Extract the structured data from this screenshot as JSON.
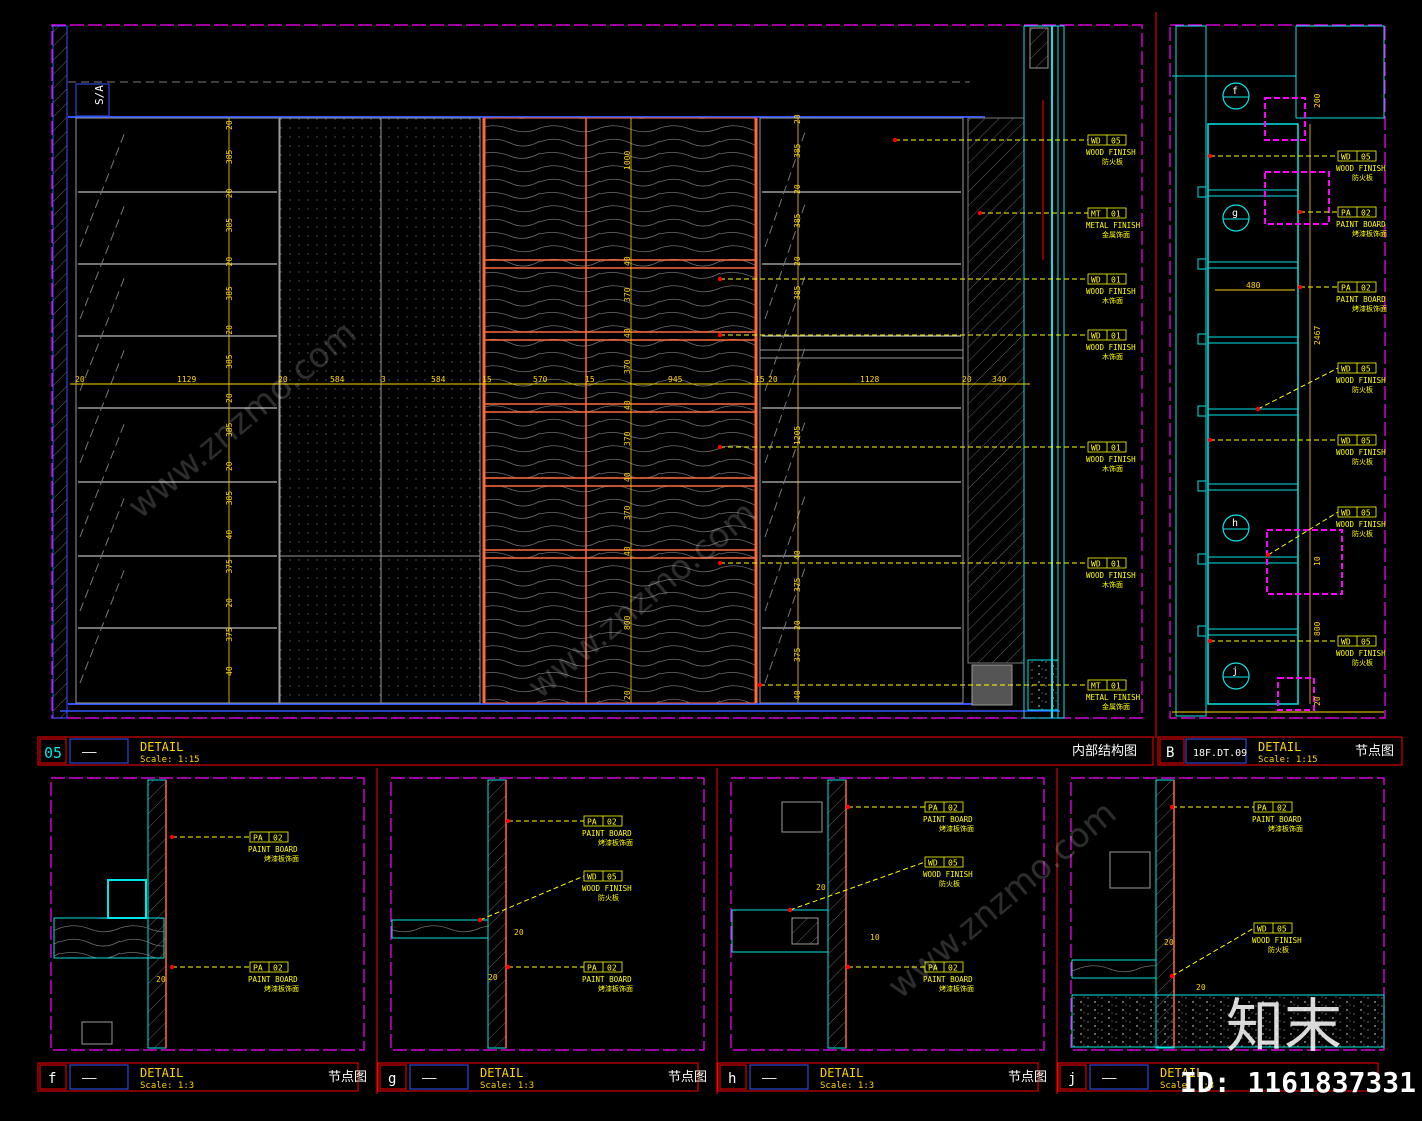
{
  "main": {
    "tag_sa": "S/A",
    "title_num": "05",
    "title_ref": "——",
    "title": "DETAIL",
    "scale": "Scale: 1:15",
    "title_cn": "内部结构图",
    "dims_h": [
      "20",
      "1129",
      "20",
      "584",
      "3",
      "584",
      "15",
      "570",
      "15",
      "945",
      "15",
      "20",
      "1128",
      "20",
      "340"
    ],
    "dims_v_left": [
      "20",
      "385",
      "20",
      "385",
      "20",
      "385",
      "20",
      "385",
      "20",
      "385",
      "20",
      "385",
      "40",
      "375",
      "20",
      "375",
      "40"
    ],
    "dims_v_mid": [
      "1000",
      "40",
      "370",
      "40",
      "370",
      "40",
      "370",
      "40",
      "370",
      "40",
      "800",
      "20"
    ],
    "dims_v_right": [
      "20",
      "385",
      "20",
      "385",
      "20",
      "385",
      "1205",
      "40",
      "375",
      "20",
      "375",
      "40"
    ],
    "callouts": [
      {
        "code": "WD",
        "num": "05",
        "line1": "WOOD FINISH",
        "line2": "防火板"
      },
      {
        "code": "MT",
        "num": "01",
        "line1": "METAL FINISH",
        "line2": "金属饰面"
      },
      {
        "code": "WD",
        "num": "01",
        "line1": "WOOD FINISH",
        "line2": "木饰面"
      },
      {
        "code": "WD",
        "num": "01",
        "line1": "WOOD FINISH",
        "line2": "木饰面"
      },
      {
        "code": "WD",
        "num": "01",
        "line1": "WOOD FINISH",
        "line2": "木饰面"
      },
      {
        "code": "WD",
        "num": "01",
        "line1": "WOOD FINISH",
        "line2": "木饰面"
      },
      {
        "code": "MT",
        "num": "01",
        "line1": "METAL FINISH",
        "line2": "金属饰面"
      }
    ]
  },
  "section_b": {
    "title_num": "B",
    "title_ref": "18F.DT.09",
    "title": "DETAIL",
    "scale": "Scale: 1:15",
    "title_cn": "节点图",
    "markers": [
      "f",
      "g",
      "h",
      "j"
    ],
    "dims": [
      "200",
      "480",
      "2467",
      "10",
      "800",
      "20"
    ],
    "callouts": [
      {
        "code": "WD",
        "num": "05",
        "line1": "WOOD FINISH",
        "line2": "防火板"
      },
      {
        "code": "PA",
        "num": "02",
        "line1": "PAINT BOARD",
        "line2": "烤漆板饰面"
      },
      {
        "code": "PA",
        "num": "02",
        "line1": "PAINT BOARD",
        "line2": "烤漆板饰面"
      },
      {
        "code": "WD",
        "num": "05",
        "line1": "WOOD FINISH",
        "line2": "防火板"
      },
      {
        "code": "WD",
        "num": "05",
        "line1": "WOOD FINISH",
        "line2": "防火板"
      },
      {
        "code": "WD",
        "num": "05",
        "line1": "WOOD FINISH",
        "line2": "防火板"
      },
      {
        "code": "WD",
        "num": "05",
        "line1": "WOOD FINISH",
        "line2": "防火板"
      }
    ]
  },
  "details": [
    {
      "id": "f",
      "title_ref": "——",
      "title": "DETAIL",
      "scale": "Scale: 1:3",
      "title_cn": "节点图",
      "dims": [
        "20"
      ],
      "callouts": [
        {
          "code": "PA",
          "num": "02",
          "line1": "PAINT BOARD",
          "line2": "烤漆板饰面"
        },
        {
          "code": "PA",
          "num": "02",
          "line1": "PAINT BOARD",
          "line2": "烤漆板饰面"
        }
      ]
    },
    {
      "id": "g",
      "title_ref": "——",
      "title": "DETAIL",
      "scale": "Scale: 1:3",
      "title_cn": "节点图",
      "dims": [
        "20",
        "20"
      ],
      "callouts": [
        {
          "code": "PA",
          "num": "02",
          "line1": "PAINT BOARD",
          "line2": "烤漆板饰面"
        },
        {
          "code": "WD",
          "num": "05",
          "line1": "WOOD FINISH",
          "line2": "防火板"
        },
        {
          "code": "PA",
          "num": "02",
          "line1": "PAINT BOARD",
          "line2": "烤漆板饰面"
        }
      ]
    },
    {
      "id": "h",
      "title_ref": "——",
      "title": "DETAIL",
      "scale": "Scale: 1:3",
      "title_cn": "节点图",
      "dims": [
        "20",
        "10"
      ],
      "callouts": [
        {
          "code": "PA",
          "num": "02",
          "line1": "PAINT BOARD",
          "line2": "烤漆板饰面"
        },
        {
          "code": "WD",
          "num": "05",
          "line1": "WOOD FINISH",
          "line2": "防火板"
        },
        {
          "code": "PA",
          "num": "02",
          "line1": "PAINT BOARD",
          "line2": "烤漆板饰面"
        }
      ]
    },
    {
      "id": "j",
      "title_ref": "——",
      "title": "DETAIL",
      "scale": "Scale: 1:3",
      "title_cn": "节点图",
      "dims": [
        "20",
        "20"
      ],
      "callouts": [
        {
          "code": "PA",
          "num": "02",
          "line1": "PAINT BOARD",
          "line2": "烤漆板饰面"
        },
        {
          "code": "WD",
          "num": "05",
          "line1": "WOOD FINISH",
          "line2": "防火板"
        }
      ]
    }
  ],
  "watermark": {
    "brand": "知末",
    "site": "www.znzmo.com",
    "id_label": "ID: 1161837331"
  },
  "colors": {
    "bg": "#000000",
    "frame": "#ff00ff",
    "title_bar": "#ff0000",
    "dim": "#ffd400",
    "callout": "#ffff00",
    "wood": "#ff6a3d",
    "blue": "#3355ff",
    "cyan": "#00e5e5",
    "white": "#ffffff",
    "grey": "#9a9a9a"
  }
}
